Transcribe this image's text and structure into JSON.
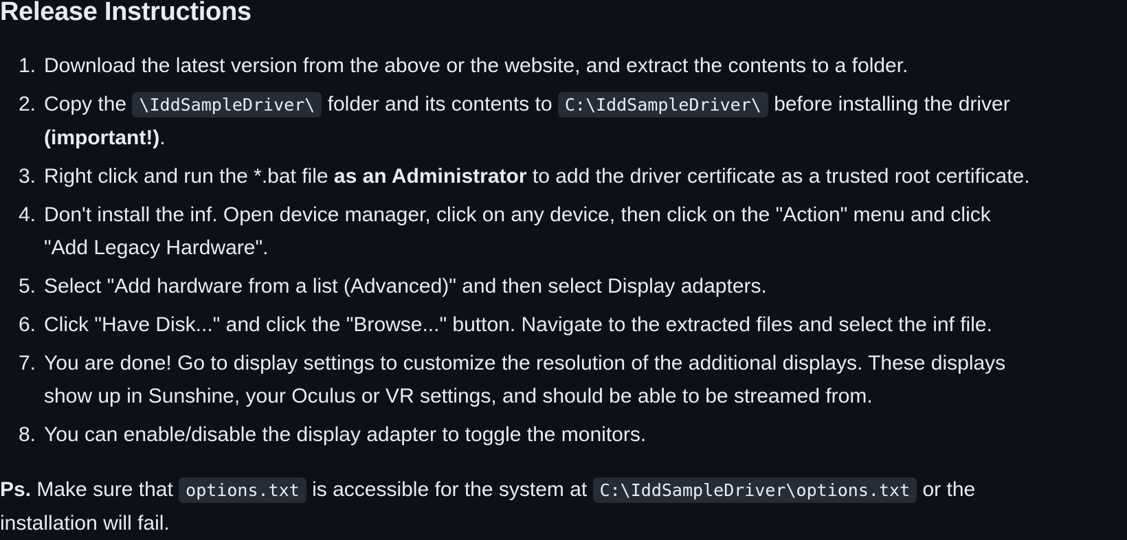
{
  "heading": "Release Instructions",
  "steps": [
    {
      "num": "1.",
      "text": "Download the latest version from the above or the website, and extract the contents to a folder."
    },
    {
      "num": "2.",
      "pre": "Copy the",
      "code1": "\\IddSampleDriver\\",
      "mid": "folder and its contents to",
      "code2": "C:\\IddSampleDriver\\",
      "post": "before installing the driver",
      "bold": "(important!)",
      "end": "."
    },
    {
      "num": "3.",
      "pre": "Right click and run the *.bat file",
      "bold": "as an Administrator",
      "post": "to add the driver certificate as a trusted root certificate."
    },
    {
      "num": "4.",
      "line1": "Don't install the inf. Open device manager, click on any device, then click on the \"Action\" menu and click",
      "line2": "\"Add Legacy Hardware\"."
    },
    {
      "num": "5.",
      "text": "Select \"Add hardware from a list (Advanced)\" and then select Display adapters."
    },
    {
      "num": "6.",
      "text": "Click \"Have Disk...\" and click the \"Browse...\" button. Navigate to the extracted files and select the inf file."
    },
    {
      "num": "7.",
      "line1": "You are done! Go to display settings to customize the resolution of the additional displays. These displays",
      "line2": "show up in Sunshine, your Oculus or VR settings, and should be able to be streamed from."
    },
    {
      "num": "8.",
      "text": "You can enable/disable the display adapter to toggle the monitors."
    }
  ],
  "ps": {
    "label": "Ps.",
    "pre": "Make sure that",
    "code1": "options.txt",
    "mid": "is accessible for the system at",
    "code2": "C:\\IddSampleDriver\\options.txt",
    "post": "or the",
    "line2": "installation will fail."
  }
}
